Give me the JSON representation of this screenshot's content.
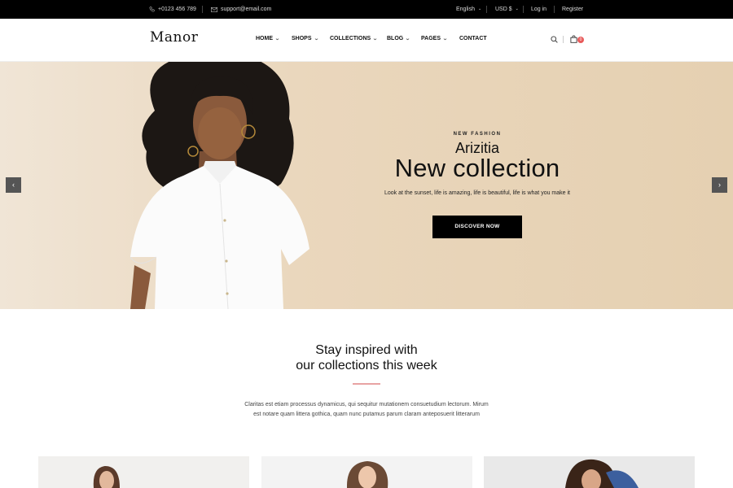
{
  "topbar": {
    "phone": "+0123 456 789",
    "email": "support@email.com",
    "language": "English",
    "currency": "USD $",
    "login": "Log in",
    "register": "Register"
  },
  "header": {
    "logo": "Manor",
    "nav": [
      {
        "label": "HOME",
        "has_dropdown": true
      },
      {
        "label": "SHOPS",
        "has_dropdown": true
      },
      {
        "label": "COLLECTIONS",
        "has_dropdown": true
      },
      {
        "label": "BLOG",
        "has_dropdown": true
      },
      {
        "label": "PAGES",
        "has_dropdown": true
      },
      {
        "label": "CONTACT",
        "has_dropdown": false
      }
    ],
    "cart_count": "0"
  },
  "hero": {
    "eyebrow": "NEW FASHION",
    "brand": "Arizitia",
    "title": "New collection",
    "description": "Look at the sunset, life is amazing, life is beautiful, life is what you make it",
    "button": "DISCOVER NOW",
    "prev": "‹",
    "next": "›"
  },
  "inspire": {
    "title_line1": "Stay inspired with",
    "title_line2": "our collections this week",
    "description": "Claritas est etiam processus dynamicus, qui sequitur mutationem consuetudium lectorum. Mirum est notare quam littera gothica, quam nunc putamus parum claram anteposuerit litterarum"
  },
  "colors": {
    "topbar_bg": "#000000",
    "hero_bg": "#E9D6BA",
    "accent_divider": "#E8A3A3",
    "cart_badge": "#E85A5A",
    "button_bg": "#000000"
  }
}
